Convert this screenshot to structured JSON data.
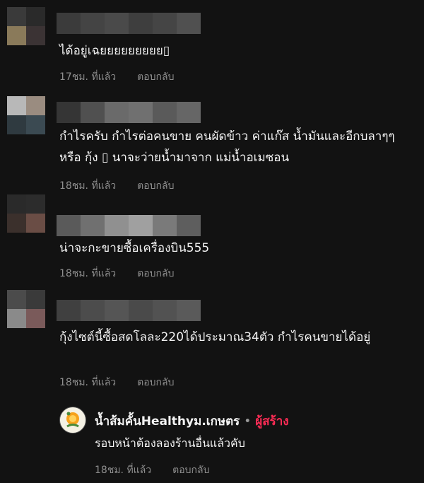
{
  "comments": [
    {
      "text": "ได้อยู่เฉยยยยยยยยย▯",
      "time": "17ชม. ที่แล้ว",
      "reply_label": "ตอบกลับ",
      "avatar_colors": [
        "#3a3a3a",
        "#2a2a2a",
        "#8a7a5a",
        "#3b3334"
      ],
      "name_blur_colors": [
        "#3b3b3b",
        "#444444",
        "#4a4a4a",
        "#3e3e3e",
        "#454545",
        "#505050"
      ]
    },
    {
      "text": "กำไรครับ กำไรต่อคนขาย คนผัดข้าว ค่าแก๊ส น้ำมันและอีกบลาๆๆ หรือ กุ้ง ▯ นาจะว่ายน้ำมาจาก แม่น้ำอเมซอน",
      "time": "18ชม. ที่แล้ว",
      "reply_label": "ตอบกลับ",
      "avatar_colors": [
        "#b8b8b8",
        "#9a8c80",
        "#2f3a40",
        "#3b4a52"
      ],
      "name_blur_colors": [
        "#353535",
        "#505050",
        "#6a6a6a",
        "#707070",
        "#5a5a5a",
        "#666666"
      ]
    },
    {
      "text": "น่าจะกะขายซื้อเครื่องบิน555",
      "time": "18ชม. ที่แล้ว",
      "reply_label": "ตอบกลับ",
      "avatar_colors": [
        "#2a2a2a",
        "#2c2c2c",
        "#3b302c",
        "#6a4d45"
      ],
      "name_blur_colors": [
        "#5a5a5a",
        "#707070",
        "#909090",
        "#a0a0a0",
        "#7a7a7a",
        "#5e5e5e"
      ]
    },
    {
      "text": "กุ้งไซต์นี้ซื้อสดโลละ220ได้ประมาณ34ตัว กำไรคนขายได้อยู่",
      "time": "18ชม. ที่แล้ว",
      "reply_label": "ตอบกลับ",
      "avatar_colors": [
        "#4b4b4b",
        "#3a3a3a",
        "#8a8a8a",
        "#7a5a5a"
      ],
      "name_blur_colors": [
        "#404040",
        "#4c4c4c",
        "#555555",
        "#4a4a4a",
        "#525252",
        "#5a5a5a"
      ]
    }
  ],
  "reply": {
    "name": "น้ำส้มคั้นHealthyม.เกษตร",
    "separator": "•",
    "creator_label": "ผู้สร้าง",
    "text": "รอบหน้าต้องลองร้านอื่นแล้วคับ",
    "time": "18ชม. ที่แล้ว",
    "reply_label": "ตอบกลับ"
  }
}
